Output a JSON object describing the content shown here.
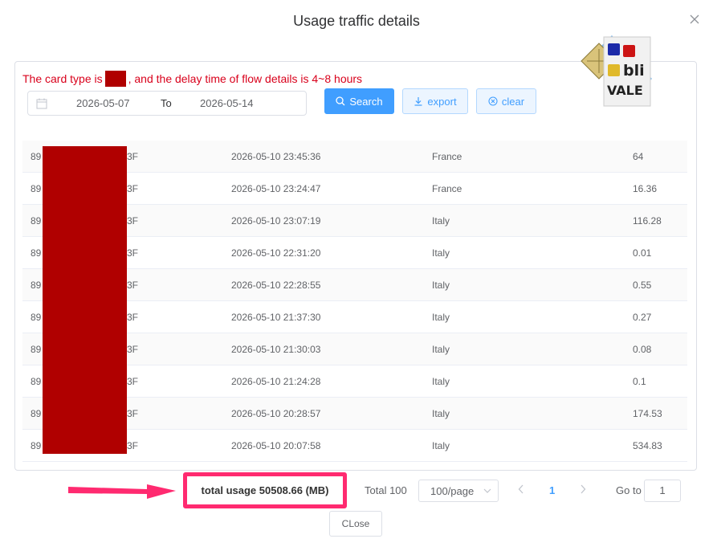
{
  "dialog": {
    "title": "Usage traffic details",
    "close_label": "CLose"
  },
  "notice": {
    "prefix": "The card type is",
    "suffix": ", and the delay time of flow details is 4~8 hours"
  },
  "filters": {
    "start_date": "2026-05-07",
    "separator": "To",
    "end_date": "2026-05-14",
    "search_label": "Search",
    "export_label": "export",
    "clear_label": "clear"
  },
  "logo": {
    "line1": "bli",
    "line2": "VALE"
  },
  "rows": [
    {
      "iccid_prefix": "89",
      "iccid_suffix": "3F",
      "time": "2026-05-10 23:45:36",
      "country": "France",
      "usage": "64"
    },
    {
      "iccid_prefix": "89",
      "iccid_suffix": "3F",
      "time": "2026-05-10 23:24:47",
      "country": "France",
      "usage": "16.36"
    },
    {
      "iccid_prefix": "89",
      "iccid_suffix": "3F",
      "time": "2026-05-10 23:07:19",
      "country": "Italy",
      "usage": "116.28"
    },
    {
      "iccid_prefix": "89",
      "iccid_suffix": "3F",
      "time": "2026-05-10 22:31:20",
      "country": "Italy",
      "usage": "0.01"
    },
    {
      "iccid_prefix": "89",
      "iccid_suffix": "3F",
      "time": "2026-05-10 22:28:55",
      "country": "Italy",
      "usage": "0.55"
    },
    {
      "iccid_prefix": "89",
      "iccid_suffix": "3F",
      "time": "2026-05-10 21:37:30",
      "country": "Italy",
      "usage": "0.27"
    },
    {
      "iccid_prefix": "89",
      "iccid_suffix": "3F",
      "time": "2026-05-10 21:30:03",
      "country": "Italy",
      "usage": "0.08"
    },
    {
      "iccid_prefix": "89",
      "iccid_suffix": "3F",
      "time": "2026-05-10 21:24:28",
      "country": "Italy",
      "usage": "0.1"
    },
    {
      "iccid_prefix": "89",
      "iccid_suffix": "3F",
      "time": "2026-05-10 20:28:57",
      "country": "Italy",
      "usage": "174.53"
    },
    {
      "iccid_prefix": "89",
      "iccid_suffix": "3F",
      "time": "2026-05-10 20:07:58",
      "country": "Italy",
      "usage": "534.83"
    }
  ],
  "footer": {
    "total_usage": "total usage 50508.66 (MB)",
    "total_count": "Total 100",
    "page_size": "100/page",
    "current_page": "1",
    "goto_label": "Go to",
    "goto_value": "1"
  },
  "colors": {
    "primary": "#409eff",
    "redaction": "#b00000",
    "notice": "#d9001b",
    "highlight": "#ff2a70"
  }
}
